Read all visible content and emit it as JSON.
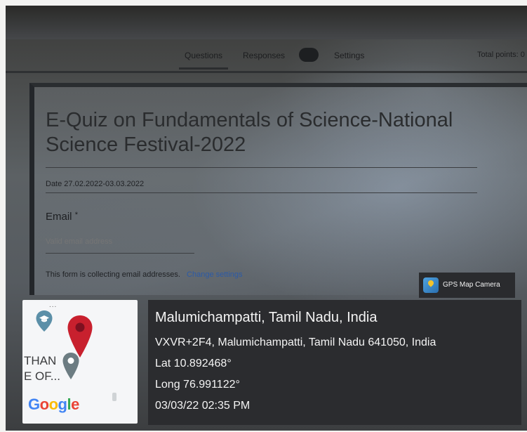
{
  "tabs": {
    "questions": "Questions",
    "responses": "Responses",
    "responses_count": "",
    "settings": "Settings",
    "total_points": "Total points: 0"
  },
  "form": {
    "title": "E-Quiz on Fundamentals of Science-National Science Festival-2022",
    "description": "Date 27.02.2022-03.03.2022",
    "email_label": "Email",
    "email_required_mark": "*",
    "email_placeholder": "Valid email address",
    "collecting_notice": "This form is collecting email addresses.",
    "change_settings_link": "Change settings"
  },
  "gps": {
    "app_name": "GPS Map Camera",
    "location_title": "Malumichampatti, Tamil Nadu, India",
    "address": "VXVR+2F4, Malumichampatti, Tamil Nadu 641050, India",
    "latitude": "Lat 10.892468°",
    "longitude": "Long 76.991122°",
    "timestamp": "03/03/22 02:35 PM"
  },
  "map": {
    "label_line1": "THAN",
    "label_line2": "E OF...",
    "google_logo": "Google",
    "more_dots": "..."
  },
  "colors": {
    "pin_red": "#c8202e",
    "pin_school": "#5b8fa8",
    "pin_gray": "#6c7c82",
    "link_blue": "#2c5aa6"
  }
}
